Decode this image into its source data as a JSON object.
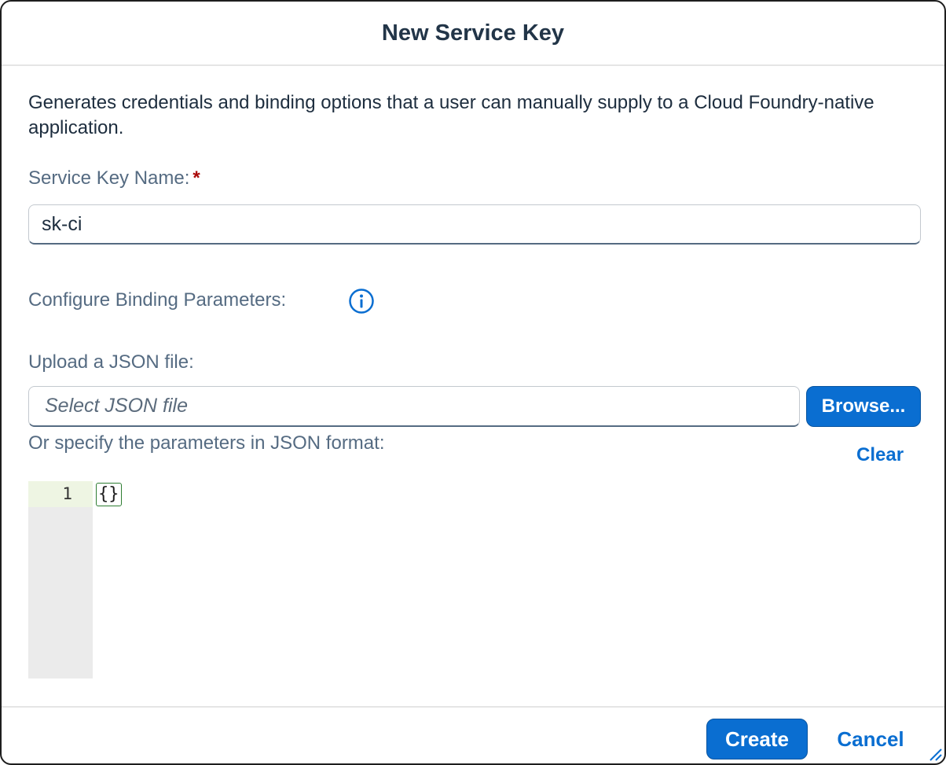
{
  "dialog": {
    "title": "New Service Key",
    "description": "Generates credentials and binding options that a user can manually supply to a Cloud Foundry-native application."
  },
  "service_key": {
    "label": "Service Key Name:",
    "required_marker": "*",
    "value": "sk-ci"
  },
  "binding": {
    "label": "Configure Binding Parameters:",
    "info_icon": "info-circle-icon"
  },
  "upload": {
    "label": "Upload a JSON file:",
    "placeholder": "Select JSON file",
    "browse_label": "Browse..."
  },
  "json_params": {
    "label": "Or specify the parameters in JSON format:",
    "clear_label": "Clear",
    "editor_lines": [
      {
        "number": "1",
        "content": "{}"
      }
    ]
  },
  "footer": {
    "create_label": "Create",
    "cancel_label": "Cancel"
  },
  "colors": {
    "accent": "#0a6ed1",
    "required": "#aa0808",
    "label_text": "#556b82"
  }
}
